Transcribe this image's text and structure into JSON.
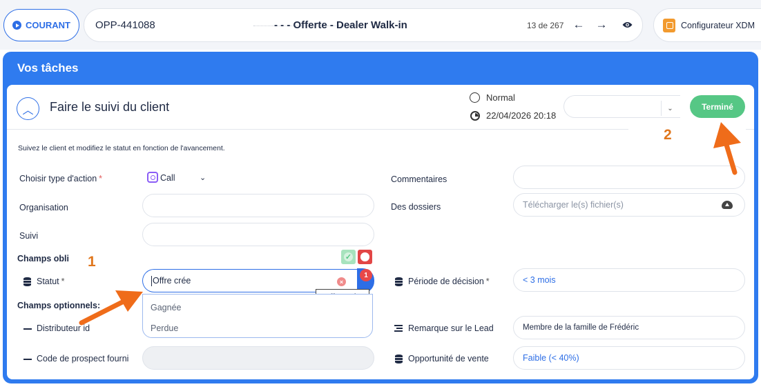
{
  "topbar": {
    "courant_label": "COURANT",
    "opp_id": "OPP-441088",
    "opp_title": "- - - Offerte - Dealer Walk-in",
    "record_counter": "13 de 267",
    "config_label": "Configurateur XDM"
  },
  "panel": {
    "title": "Vos tâches"
  },
  "task": {
    "title": "Faire le suivi du client",
    "priority": "Normal",
    "due_datetime": "22/04/2026 20:18",
    "done_label": "Terminé",
    "instructions": "Suivez le client et modifiez le statut en fonction de l'avancement."
  },
  "form": {
    "action_type_label": "Choisir type d'action",
    "action_type_value": "Call",
    "organisation_label": "Organisation",
    "suivi_label": "Suivi",
    "required_section": "Champs obli",
    "statut_label": "Statut",
    "statut_value": "Offre crée",
    "statut_badge": "1",
    "statut_tooltip": "Offre crée",
    "statut_options": [
      "Gagnée",
      "Perdue"
    ],
    "optional_section": "Champs optionnels:",
    "distributeur_label": "Distributeur id",
    "prospect_label": "Code de prospect fourni",
    "commentaires_label": "Commentaires",
    "dossiers_label": "Des dossiers",
    "dossiers_placeholder": "Télécharger le(s) fichier(s)",
    "periode_label": "Période de décision",
    "periode_value": "< 3 mois",
    "remarque_label": "Remarque sur le Lead",
    "remarque_value": "Membre de la famille de Frédéric",
    "opportunite_label": "Opportunité de vente",
    "opportunite_value": "Faible (< 40%)"
  },
  "annotations": {
    "marker_1": "1",
    "marker_2": "2",
    "color": "#e0761c"
  },
  "colors": {
    "primary": "#2f7bef",
    "success": "#56c785",
    "danger": "#e84848"
  }
}
